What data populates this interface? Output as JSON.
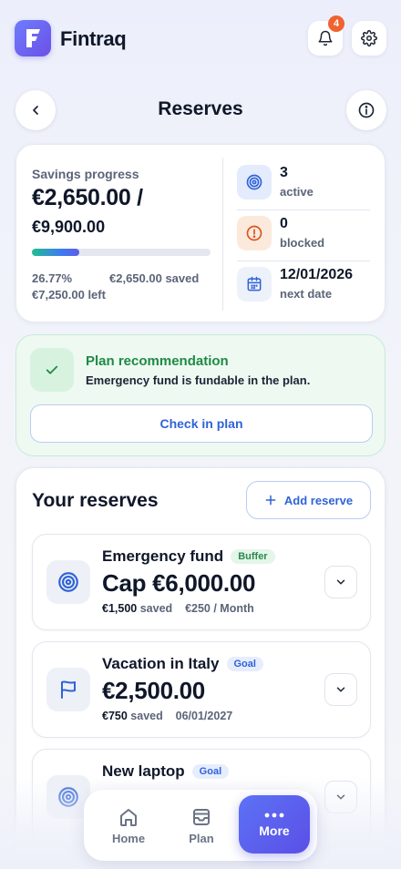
{
  "app": {
    "name": "Fintraq",
    "notification_count": "4"
  },
  "header": {
    "title": "Reserves"
  },
  "summary": {
    "label": "Savings progress",
    "amount": "€2,650.00 /",
    "target": "€9,900.00",
    "progress_fraction": 0.2677,
    "percent": "26.77%",
    "saved": "€2,650.00 saved",
    "left": "€7,250.00 left",
    "stats": [
      {
        "value": "3",
        "label": "active",
        "icon": "target-icon"
      },
      {
        "value": "0",
        "label": "blocked",
        "icon": "alert-icon"
      },
      {
        "value": "12/01/2026",
        "label": "next date",
        "icon": "calendar-icon"
      }
    ]
  },
  "recommendation": {
    "title": "Plan recommendation",
    "text": "Emergency fund is fundable in the plan.",
    "button": "Check in plan"
  },
  "reserves": {
    "title": "Your reserves",
    "add_label": "Add reserve",
    "items": [
      {
        "name": "Emergency fund",
        "tag": "Buffer",
        "amount": "Cap €6,000.00",
        "saved_value": "€1,500",
        "saved_label": "saved",
        "extra": "€250 / Month",
        "icon": "target-icon"
      },
      {
        "name": "Vacation in Italy",
        "tag": "Goal",
        "amount": "€2,500.00",
        "saved_value": "€750",
        "saved_label": "saved",
        "extra": "06/01/2027",
        "icon": "flag-icon"
      },
      {
        "name": "New laptop",
        "tag": "Goal",
        "amount": "",
        "saved_value": "",
        "saved_label": "",
        "extra": "",
        "icon": "target-icon"
      }
    ]
  },
  "tabbar": {
    "tabs": [
      {
        "label": "Home",
        "icon": "home-icon"
      },
      {
        "label": "Plan",
        "icon": "inbox-icon"
      },
      {
        "label": "More",
        "icon": "more-icon"
      }
    ]
  },
  "colors": {
    "accent": "#5a5fe8",
    "success": "#1e8a45",
    "link": "#2f63d8",
    "badge": "#f0622f"
  }
}
